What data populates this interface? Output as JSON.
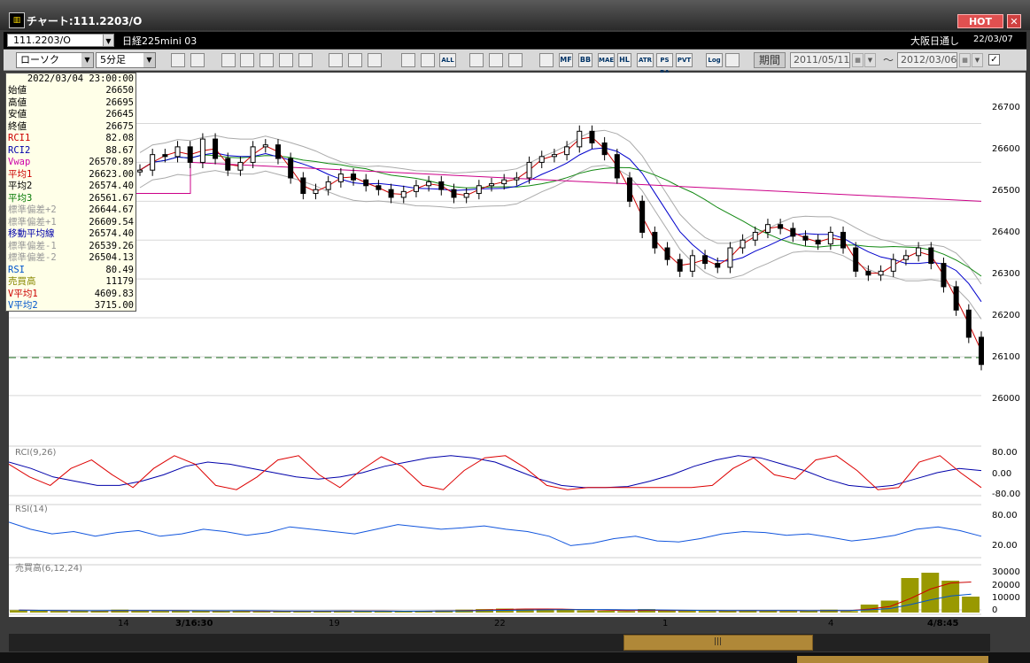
{
  "window": {
    "title": "チャート:111.2203/O",
    "icon": "chart-app-icon",
    "hot_label": "HOT",
    "close_label": "✕"
  },
  "header": {
    "symbol_code": "111.2203/O",
    "symbol_name": "日経225mini 03",
    "market": "大阪日通し",
    "date": "22/03/07"
  },
  "toolbar": {
    "chart_type": "ローソク",
    "interval": "5分足",
    "icons": [
      "zoom-icon",
      "layout-icon",
      "candle-icon",
      "search-chart-icon",
      "bar-icon",
      "split-icon",
      "alert-icon",
      "pen-icon",
      "cursor-icon",
      "undo-icon",
      "stock-a-icon",
      "stock-b-icon",
      "all-icon",
      "settings-icon",
      "brush-icon",
      "color-icon",
      "pf-icon",
      "mf-icon",
      "bb-icon",
      "mae-icon",
      "hl-icon",
      "atr-icon",
      "psra-icon",
      "pvt-icon",
      "log-icon",
      "export-icon"
    ],
    "icon_labels": [
      "",
      "",
      "",
      "",
      "",
      "",
      "",
      "",
      "",
      "",
      "",
      "",
      "ALL",
      "",
      "",
      "",
      "",
      "MF",
      "BB",
      "MAE",
      "HL",
      "ATR",
      "PS RA",
      "PVT",
      "Log",
      ""
    ],
    "period_label": "期間",
    "date_from": "2011/05/11",
    "date_to": "2012/03/06",
    "tilde": "～",
    "check": "✓"
  },
  "info": {
    "datetime": "2022/03/04 23:00:00",
    "rows": [
      {
        "label": "始値",
        "value": "26650",
        "color": "#000000"
      },
      {
        "label": "高値",
        "value": "26695",
        "color": "#000000"
      },
      {
        "label": "安値",
        "value": "26645",
        "color": "#000000"
      },
      {
        "label": "終値",
        "value": "26675",
        "color": "#000000"
      },
      {
        "label": "RCI1",
        "value": "82.08",
        "color": "#cc0000"
      },
      {
        "label": "RCI2",
        "value": "88.67",
        "color": "#0000aa"
      },
      {
        "label": "Vwap",
        "value": "26570.89",
        "color": "#cc00aa"
      },
      {
        "label": "平均1",
        "value": "26623.00",
        "color": "#cc0000"
      },
      {
        "label": "平均2",
        "value": "26574.40",
        "color": "#000000"
      },
      {
        "label": "平均3",
        "value": "26561.67",
        "color": "#007700"
      },
      {
        "label": "標準偏差+2",
        "value": "26644.67",
        "color": "#999999"
      },
      {
        "label": "標準偏差+1",
        "value": "26609.54",
        "color": "#999999"
      },
      {
        "label": "移動平均線",
        "value": "26574.40",
        "color": "#0000aa"
      },
      {
        "label": "標準偏差-1",
        "value": "26539.26",
        "color": "#999999"
      },
      {
        "label": "標準偏差-2",
        "value": "26504.13",
        "color": "#999999"
      },
      {
        "label": "RSI",
        "value": "80.49",
        "color": "#0055cc"
      },
      {
        "label": "売買高",
        "value": "11179",
        "color": "#888800"
      },
      {
        "label": "V平均1",
        "value": "4609.83",
        "color": "#cc0000"
      },
      {
        "label": "V平均2",
        "value": "3715.00",
        "color": "#0055cc"
      }
    ]
  },
  "panels": {
    "rci_label": "RCI(9,26)",
    "rsi_label": "RSI(14)",
    "vol_label": "売買高(6,12,24)"
  },
  "chart_data": [
    {
      "type": "line",
      "title": "",
      "y_axis_ticks": [
        "26700",
        "26600",
        "26500",
        "26400",
        "26300",
        "26200",
        "26100",
        "26000"
      ],
      "x_tick_labels": [
        "14",
        "3/16:30",
        "19",
        "22",
        "1",
        "4",
        "4/8:45"
      ],
      "ylim": [
        25920,
        26790
      ],
      "series": [
        {
          "name": "終値",
          "color": "#000000",
          "values": [
            26580,
            26620,
            26615,
            26640,
            26600,
            26660,
            26610,
            26580,
            26600,
            26640,
            26645,
            26610,
            26560,
            26520,
            26530,
            26550,
            26570,
            26555,
            26540,
            26530,
            26510,
            26525,
            26540,
            26550,
            26530,
            26510,
            26520,
            26540,
            26545,
            26555,
            26560,
            26600,
            26615,
            26620,
            26640,
            26680,
            26650,
            26620,
            26560,
            26500,
            26420,
            26380,
            26350,
            26320,
            26360,
            26340,
            26330,
            26380,
            26400,
            26420,
            26440,
            26430,
            26410,
            26400,
            26390,
            26420,
            26380,
            26320,
            26310,
            26320,
            26350,
            26360,
            26380,
            26340,
            26280,
            26220,
            26150,
            26080
          ]
        },
        {
          "name": "RCI1",
          "color": "#cc0000",
          "values": [
            40,
            -20,
            -60,
            20,
            60,
            -10,
            -70,
            20,
            80,
            40,
            -60,
            -80,
            -20,
            60,
            80,
            -10,
            -70,
            10,
            75,
            30,
            -60,
            -80,
            10,
            70,
            80,
            20,
            -60,
            -80,
            -70,
            -70,
            -70,
            -70,
            -70,
            -70,
            -60,
            20,
            70,
            -10,
            -30,
            60,
            80,
            10,
            -80,
            -70,
            50,
            80,
            0,
            -70
          ]
        },
        {
          "name": "RCI2",
          "color": "#0000aa",
          "values": [
            50,
            20,
            -20,
            -40,
            -60,
            -60,
            -40,
            -10,
            30,
            50,
            40,
            20,
            0,
            -20,
            -30,
            -20,
            0,
            30,
            50,
            70,
            80,
            70,
            50,
            10,
            -30,
            -60,
            -70,
            -70,
            -65,
            -40,
            -10,
            30,
            60,
            80,
            70,
            40,
            10,
            -30,
            -60,
            -70,
            -60,
            -30,
            0,
            20,
            10
          ]
        },
        {
          "name": "RSI",
          "color": "#1155dd",
          "values": [
            70,
            55,
            45,
            50,
            40,
            48,
            52,
            40,
            45,
            55,
            50,
            42,
            48,
            60,
            55,
            50,
            45,
            55,
            65,
            60,
            55,
            58,
            62,
            55,
            50,
            40,
            20,
            25,
            35,
            40,
            30,
            28,
            35,
            45,
            50,
            48,
            42,
            45,
            38,
            30,
            35,
            42,
            55,
            60,
            52,
            40
          ]
        },
        {
          "name": "売買高",
          "color": "#888800",
          "values": [
            1800,
            1500,
            1200,
            1000,
            1400,
            2200,
            1300,
            1100,
            1600,
            1200,
            1000,
            1300,
            900,
            800,
            1100,
            1200,
            1400,
            1000,
            900,
            800,
            1200,
            1600,
            2200,
            2600,
            3000,
            2800,
            2400,
            2000,
            1600,
            1300,
            1100,
            2600,
            1500,
            1300,
            1200,
            1600,
            1800,
            1400,
            1200,
            1300,
            2200,
            1100,
            6000,
            9000,
            26000,
            30000,
            24000,
            12000
          ]
        }
      ]
    }
  ]
}
